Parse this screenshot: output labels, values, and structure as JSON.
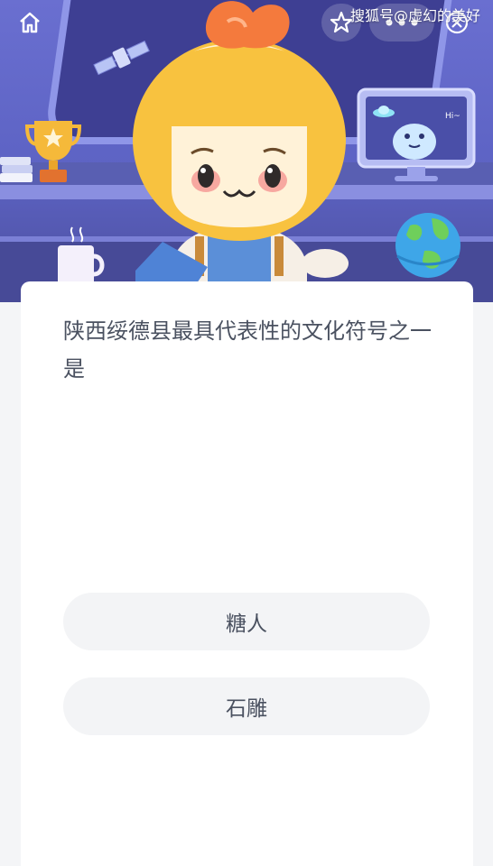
{
  "header": {
    "home_icon": "home-icon",
    "favorite_icon": "star-icon",
    "more_icon": "more-dots-icon",
    "close_icon": "close-circle-icon",
    "watermark": "搜狐号@虚幻的美好"
  },
  "banner": {
    "monitor_text": "Hi~"
  },
  "quiz": {
    "question": "陕西绥德县最具代表性的文化符号之一是",
    "options": [
      {
        "label": "糖人"
      },
      {
        "label": "石雕"
      }
    ]
  },
  "colors": {
    "banner_bg": "#5d63c4",
    "mascot_yellow": "#f8c23f",
    "mascot_leaf": "#f47a3d",
    "text": "#4a5160",
    "option_bg": "#f3f4f6",
    "page_bg": "#f4f5f7"
  }
}
